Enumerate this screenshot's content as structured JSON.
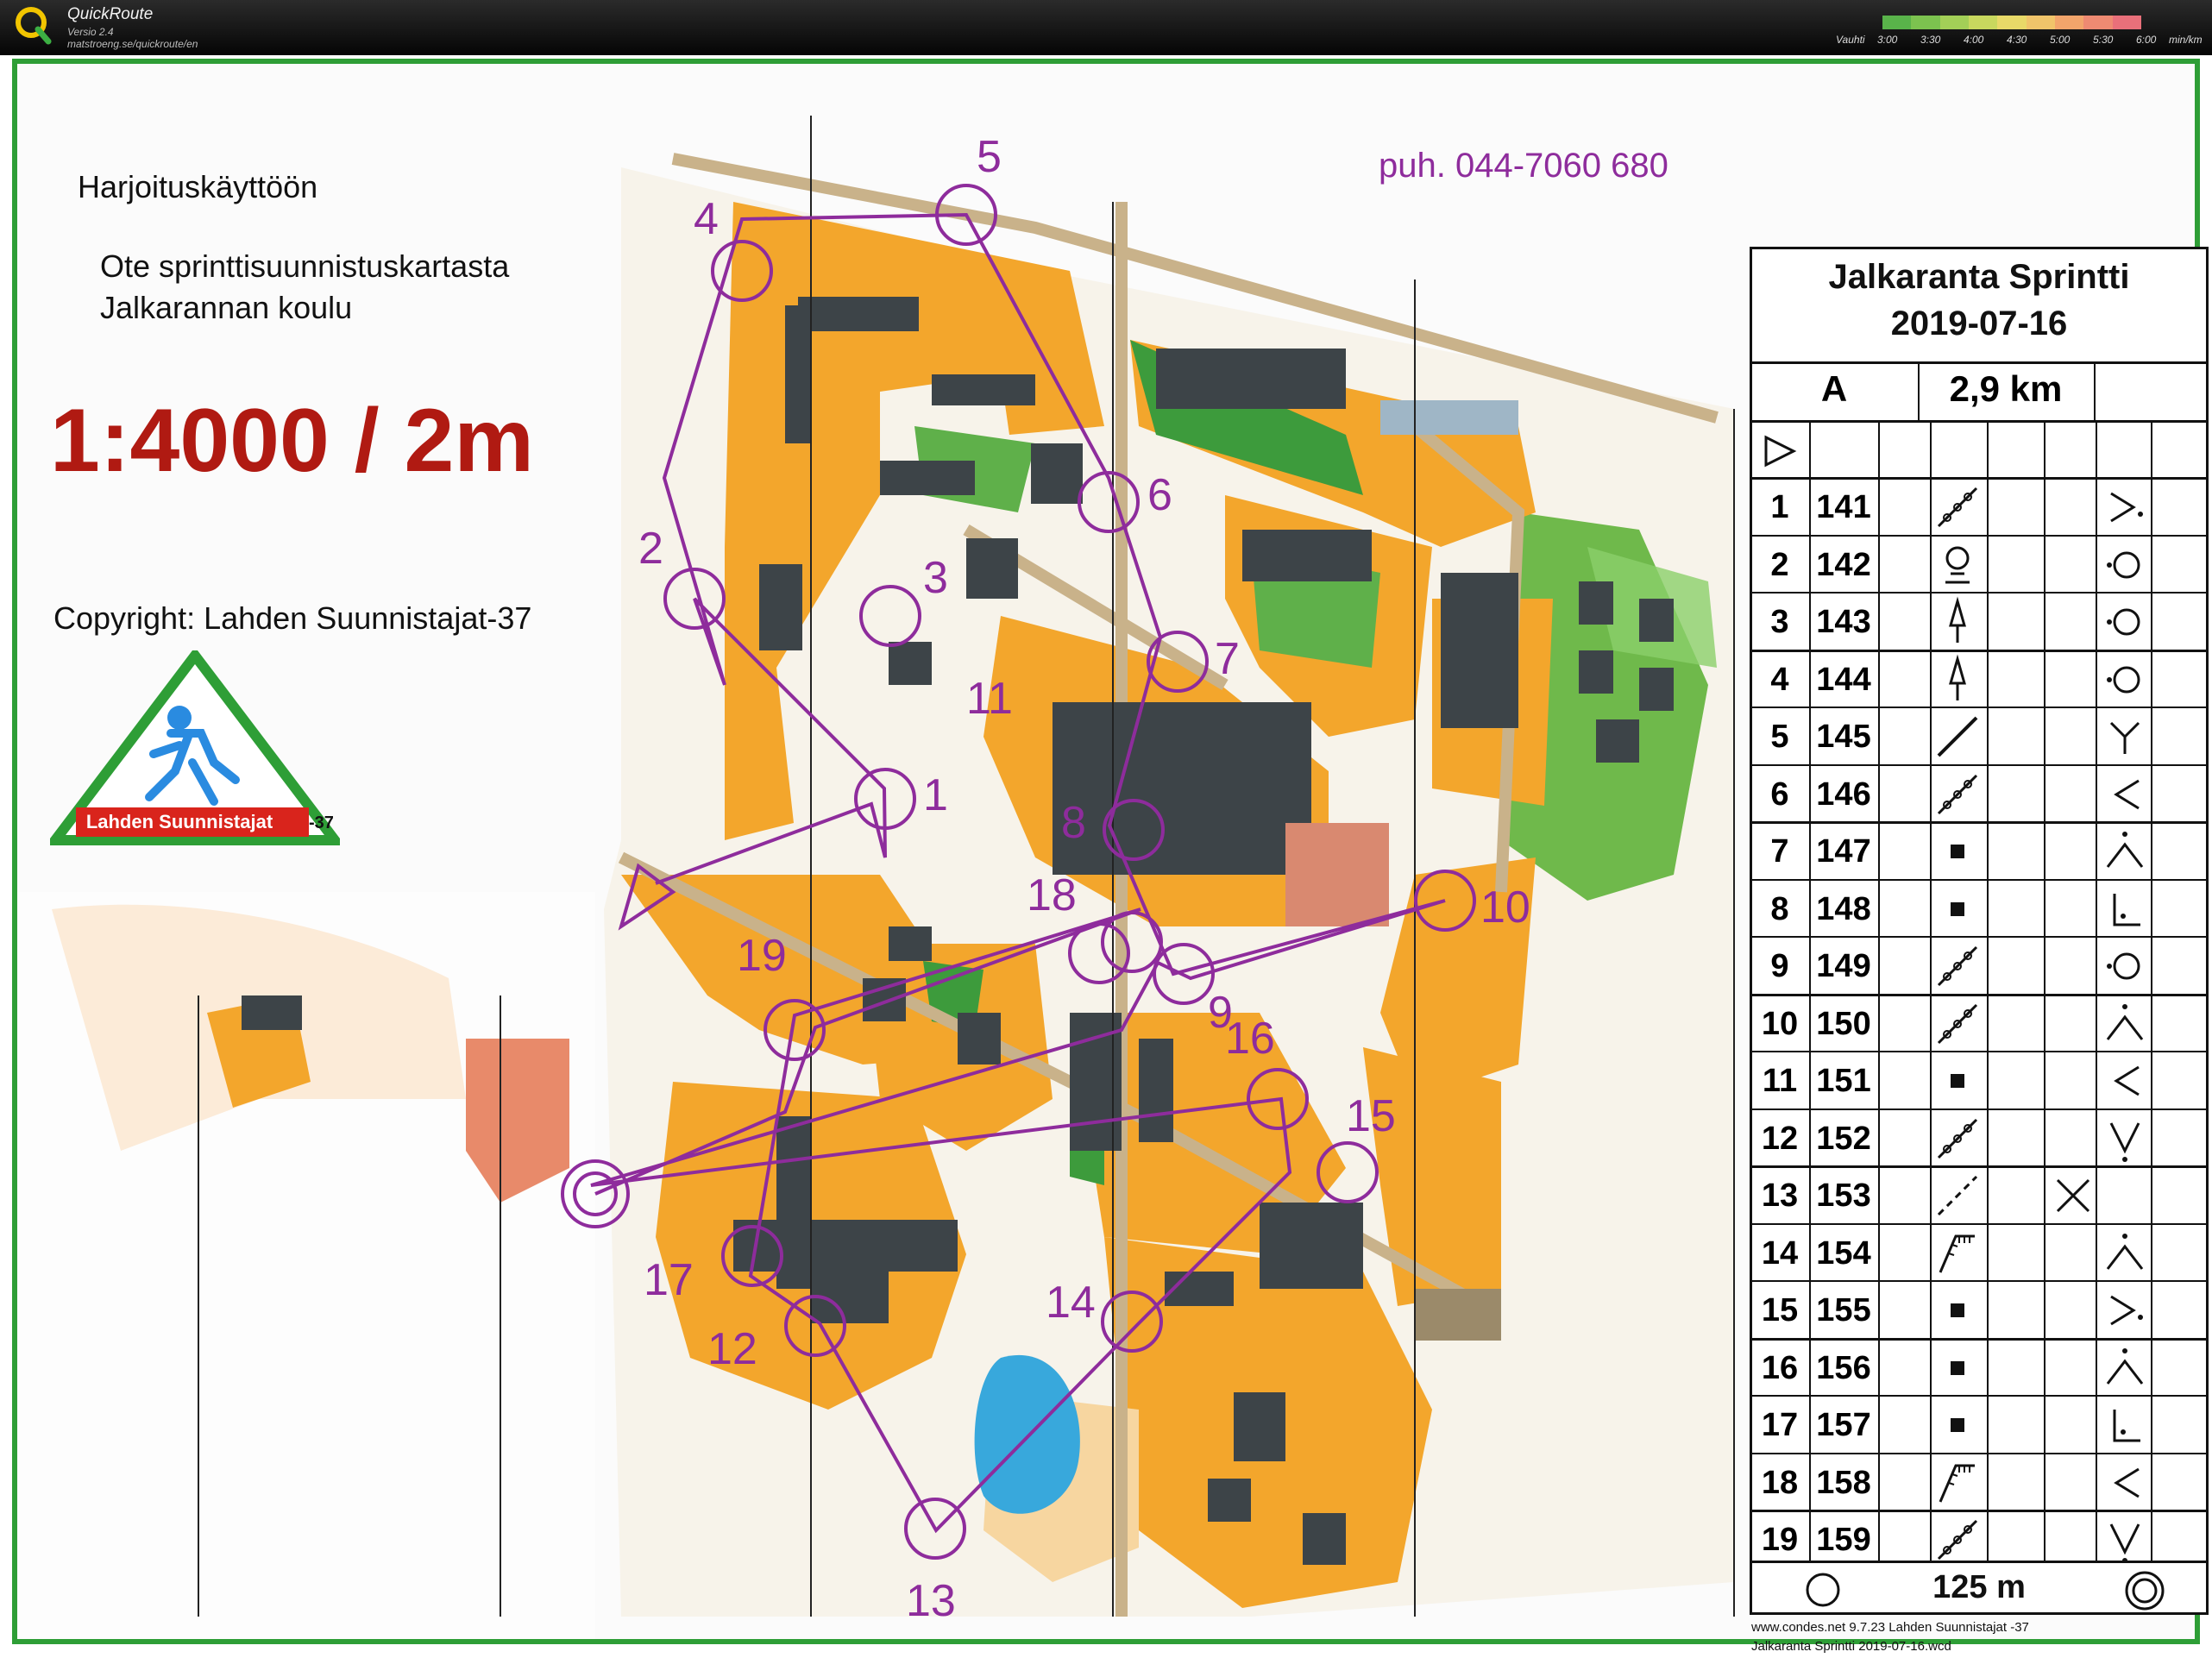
{
  "app": {
    "title": "QuickRoute",
    "version": "Versio 2.4",
    "url": "matstroeng.se/quickroute/en"
  },
  "pace_legend": {
    "label": "Vauhti",
    "ticks": [
      "3:00",
      "3:30",
      "4:00",
      "4:30",
      "5:00",
      "5:30",
      "6:00"
    ],
    "unit": "min/km",
    "colors": [
      "#59b34a",
      "#7cc24f",
      "#a3cf57",
      "#c8d85e",
      "#e8d968",
      "#f0c46a",
      "#f2a56b",
      "#ee8a72",
      "#e9707a"
    ]
  },
  "map": {
    "practice_note": "Harjoituskäyttöön",
    "excerpt_line1": "Ote sprinttisuunnistuskartasta",
    "excerpt_line2": "Jalkarannan koulu",
    "scale": "1:4000 / 2m",
    "copyright": "Copyright: Lahden Suunnistajat-37",
    "club_banner": "Lahden Suunnistajat",
    "club_suffix": "-37",
    "phone": "puh. 044-7060 680",
    "footer_line1": "www.condes.net 9.7.23 Lahden Suunnistajat -37",
    "footer_line2": "Jalkaranta Sprintti 2019-07-16.wcd",
    "colors": {
      "course": "#8e2c9c",
      "scale_red": "#b01a12",
      "border_green": "#2e9e36",
      "urban_orange": "#f3a62c",
      "building": "#3d4448",
      "water": "#38a8dc"
    }
  },
  "control_labels": [
    "1",
    "2",
    "3",
    "4",
    "5",
    "6",
    "7",
    "8",
    "9",
    "10",
    "11",
    "12",
    "13",
    "14",
    "15",
    "16",
    "17",
    "18",
    "19"
  ],
  "control_descriptions": {
    "title": "Jalkaranta Sprintti",
    "date": "2019-07-16",
    "class": "A",
    "length": "2,9 km",
    "finish_distance": "125 m",
    "rows": [
      {
        "num": "1",
        "code": "141",
        "feature": "wall",
        "loc": "corner-right"
      },
      {
        "num": "2",
        "code": "142",
        "feature": "tree",
        "loc": "side-circle"
      },
      {
        "num": "3",
        "code": "143",
        "feature": "lamp",
        "loc": "side-circle"
      },
      {
        "num": "4",
        "code": "144",
        "feature": "lamp",
        "loc": "side-circle"
      },
      {
        "num": "5",
        "code": "145",
        "feature": "fence",
        "loc": "junction"
      },
      {
        "num": "6",
        "code": "146",
        "feature": "wall",
        "loc": "corner-left"
      },
      {
        "num": "7",
        "code": "147",
        "feature": "square",
        "loc": "corner-top"
      },
      {
        "num": "8",
        "code": "148",
        "feature": "square",
        "loc": "corner-inside"
      },
      {
        "num": "9",
        "code": "149",
        "feature": "wall",
        "loc": "side-circle"
      },
      {
        "num": "10",
        "code": "150",
        "feature": "wall",
        "loc": "corner-top"
      },
      {
        "num": "11",
        "code": "151",
        "feature": "square",
        "loc": "corner-left"
      },
      {
        "num": "12",
        "code": "152",
        "feature": "wall",
        "loc": "corner-bottom"
      },
      {
        "num": "13",
        "code": "153",
        "feature": "dashed",
        "loc": "cross"
      },
      {
        "num": "14",
        "code": "154",
        "feature": "cliff",
        "loc": "corner-top"
      },
      {
        "num": "15",
        "code": "155",
        "feature": "square",
        "loc": "corner-right"
      },
      {
        "num": "16",
        "code": "156",
        "feature": "square",
        "loc": "corner-top"
      },
      {
        "num": "17",
        "code": "157",
        "feature": "square",
        "loc": "corner-inside"
      },
      {
        "num": "18",
        "code": "158",
        "feature": "cliff",
        "loc": "corner-left"
      },
      {
        "num": "19",
        "code": "159",
        "feature": "wall",
        "loc": "corner-bottom"
      }
    ]
  }
}
